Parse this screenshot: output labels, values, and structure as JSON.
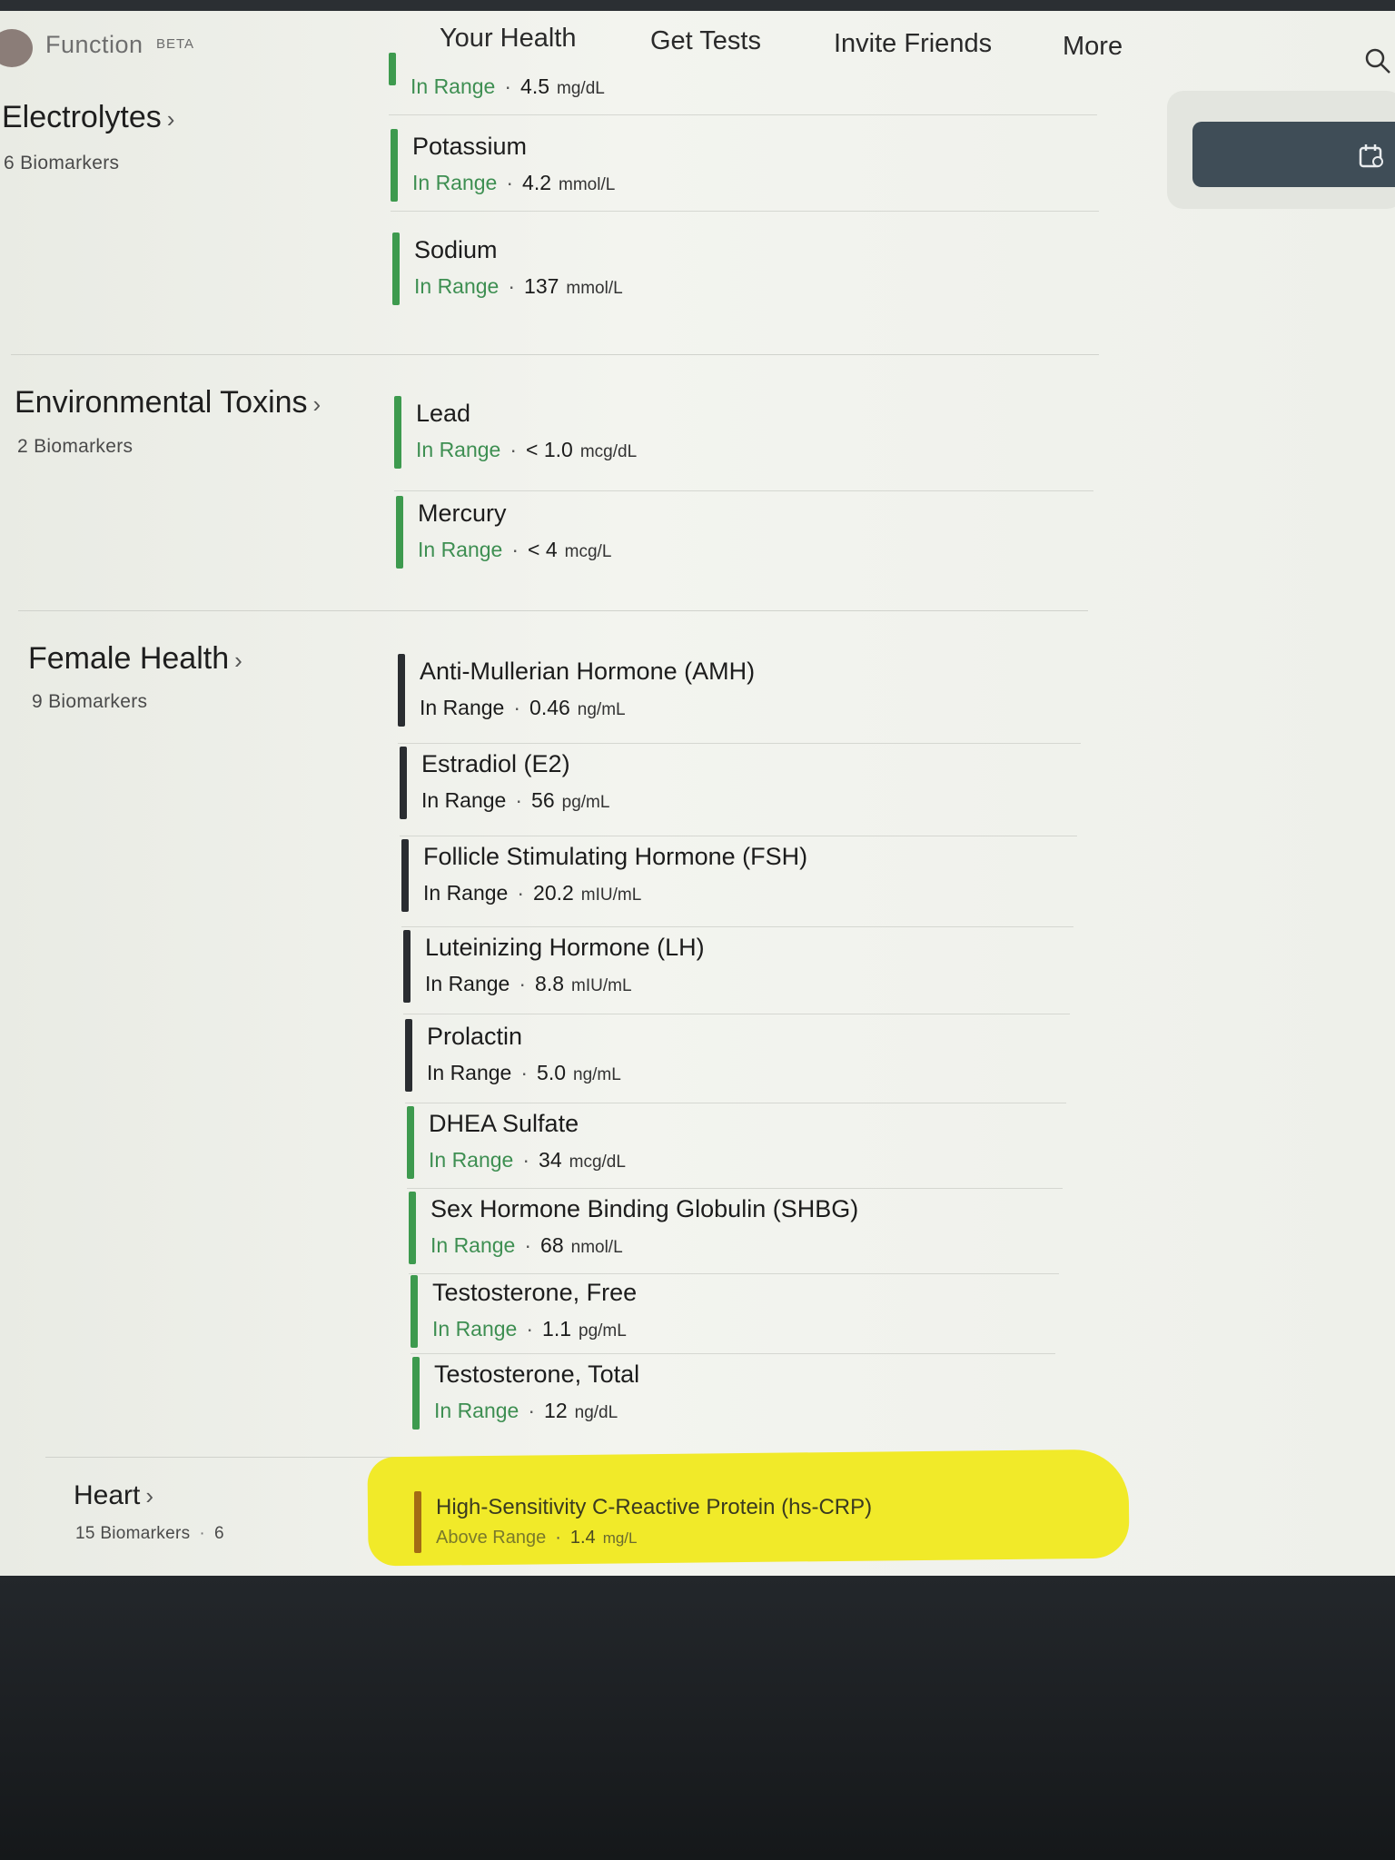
{
  "header": {
    "brand": "Function",
    "badge": "BETA",
    "nav": [
      {
        "label": "Your Health"
      },
      {
        "label": "Get Tests"
      },
      {
        "label": "Invite Friends"
      },
      {
        "label": "More"
      }
    ]
  },
  "sections": [
    {
      "title": "Electrolytes",
      "count": "6 Biomarkers",
      "biomarkers": [
        {
          "name": "",
          "status": "In Range",
          "value": "4.5",
          "unit": "mg/dL"
        },
        {
          "name": "Potassium",
          "status": "In Range",
          "value": "4.2",
          "unit": "mmol/L"
        },
        {
          "name": "Sodium",
          "status": "In Range",
          "value": "137",
          "unit": "mmol/L"
        }
      ]
    },
    {
      "title": "Environmental Toxins",
      "count": "2 Biomarkers",
      "biomarkers": [
        {
          "name": "Lead",
          "status": "In Range",
          "value": "< 1.0",
          "unit": "mcg/dL"
        },
        {
          "name": "Mercury",
          "status": "In Range",
          "value": "< 4",
          "unit": "mcg/L"
        }
      ]
    },
    {
      "title": "Female Health",
      "count": "9 Biomarkers",
      "biomarkers": [
        {
          "name": "Anti-Mullerian Hormone (AMH)",
          "status": "In Range",
          "value": "0.46",
          "unit": "ng/mL"
        },
        {
          "name": "Estradiol (E2)",
          "status": "In Range",
          "value": "56",
          "unit": "pg/mL"
        },
        {
          "name": "Follicle Stimulating Hormone (FSH)",
          "status": "In Range",
          "value": "20.2",
          "unit": "mIU/mL"
        },
        {
          "name": "Luteinizing Hormone (LH)",
          "status": "In Range",
          "value": "8.8",
          "unit": "mIU/mL"
        },
        {
          "name": "Prolactin",
          "status": "In Range",
          "value": "5.0",
          "unit": "ng/mL"
        },
        {
          "name": "DHEA Sulfate",
          "status": "In Range",
          "value": "34",
          "unit": "mcg/dL"
        },
        {
          "name": "Sex Hormone Binding Globulin (SHBG)",
          "status": "In Range",
          "value": "68",
          "unit": "nmol/L"
        },
        {
          "name": "Testosterone, Free",
          "status": "In Range",
          "value": "1.1",
          "unit": "pg/mL"
        },
        {
          "name": "Testosterone, Total",
          "status": "In Range",
          "value": "12",
          "unit": "ng/dL"
        }
      ]
    },
    {
      "title": "Heart",
      "count": "15 Biomarkers",
      "count_extra": "6",
      "biomarkers": [
        {
          "name": "High-Sensitivity C-Reactive Protein (hs-CRP)",
          "status": "Above Range",
          "value": "1.4",
          "unit": "mg/L"
        }
      ]
    }
  ],
  "colors": {
    "in_range": "#3e8f52",
    "above_range": "#a36b14",
    "highlight": "#f1ea29"
  }
}
